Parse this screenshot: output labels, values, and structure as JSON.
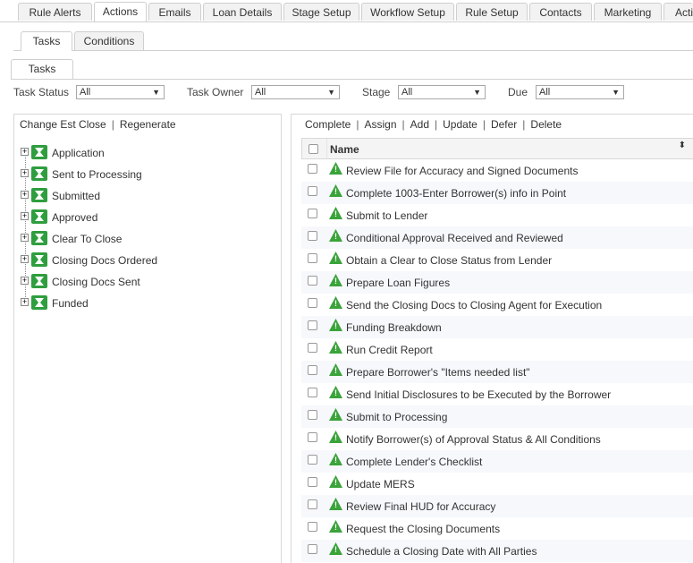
{
  "top_tabs": [
    {
      "label": "Rule Alerts",
      "active": false
    },
    {
      "label": "Actions",
      "active": true
    },
    {
      "label": "Emails",
      "active": false
    },
    {
      "label": "Loan Details",
      "active": false
    },
    {
      "label": "Stage Setup",
      "active": false
    },
    {
      "label": "Workflow Setup",
      "active": false
    },
    {
      "label": "Rule Setup",
      "active": false
    },
    {
      "label": "Contacts",
      "active": false
    },
    {
      "label": "Marketing",
      "active": false
    },
    {
      "label": "Acti",
      "active": false
    }
  ],
  "sub_tabs": [
    {
      "label": "Tasks",
      "active": true
    },
    {
      "label": "Conditions",
      "active": false
    }
  ],
  "inner_tab": {
    "label": "Tasks"
  },
  "filters": {
    "task_status": {
      "label": "Task Status",
      "value": "All"
    },
    "task_owner": {
      "label": "Task Owner",
      "value": "All"
    },
    "stage": {
      "label": "Stage",
      "value": "All"
    },
    "due": {
      "label": "Due",
      "value": "All"
    },
    "arrow": "▼"
  },
  "left_links": {
    "change_est_close": "Change Est Close",
    "separator": "|",
    "regenerate": "Regenerate"
  },
  "tree": {
    "expander": "+",
    "nodes": [
      {
        "label": "Application"
      },
      {
        "label": "Sent to Processing"
      },
      {
        "label": "Submitted"
      },
      {
        "label": "Approved"
      },
      {
        "label": "Clear To Close"
      },
      {
        "label": "Closing Docs Ordered"
      },
      {
        "label": "Closing Docs Sent"
      },
      {
        "label": "Funded"
      }
    ]
  },
  "actions": {
    "complete": "Complete",
    "assign": "Assign",
    "add": "Add",
    "update": "Update",
    "defer": "Defer",
    "delete": "Delete",
    "separator": "|"
  },
  "grid": {
    "header": {
      "name": "Name",
      "sort_icon": "⬍"
    },
    "rows": [
      {
        "name": "Review File for Accuracy and Signed Documents"
      },
      {
        "name": "Complete 1003-Enter Borrower(s) info in Point"
      },
      {
        "name": "Submit to Lender"
      },
      {
        "name": "Conditional Approval Received and Reviewed"
      },
      {
        "name": "Obtain a Clear to Close Status from Lender"
      },
      {
        "name": "Prepare Loan Figures"
      },
      {
        "name": "Send the Closing Docs to Closing Agent for Execution"
      },
      {
        "name": "Funding Breakdown"
      },
      {
        "name": "Run Credit Report"
      },
      {
        "name": "Prepare Borrower's \"Items needed list\""
      },
      {
        "name": "Send Initial Disclosures to be Executed by the Borrower"
      },
      {
        "name": "Submit to Processing"
      },
      {
        "name": "Notify Borrower(s) of Approval Status & All Conditions"
      },
      {
        "name": "Complete Lender's Checklist"
      },
      {
        "name": "Update MERS"
      },
      {
        "name": "Review Final HUD for Accuracy"
      },
      {
        "name": "Request the Closing Documents"
      },
      {
        "name": "Schedule a Closing Date with All Parties"
      }
    ]
  },
  "colors": {
    "accent_green": "#2e9e3e",
    "warning_green": "#3aa33a"
  },
  "icons": {
    "stage": "hourglass-icon",
    "task": "warning-triangle-icon"
  }
}
